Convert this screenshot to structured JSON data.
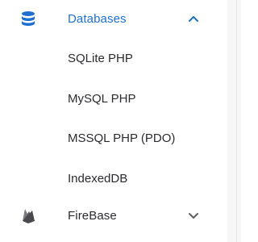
{
  "nav": {
    "databases": {
      "label": "Databases",
      "icon": "database-icon",
      "expanded": true,
      "chevron": "chevron-up-icon",
      "color": "#1f6fd1",
      "children": [
        {
          "label": "SQLite PHP"
        },
        {
          "label": "MySQL PHP"
        },
        {
          "label": "MSSQL PHP (PDO)"
        },
        {
          "label": "IndexedDB"
        }
      ]
    },
    "firebase": {
      "label": "FireBase",
      "icon": "firebase-icon",
      "expanded": false,
      "chevron": "chevron-down-icon"
    }
  }
}
